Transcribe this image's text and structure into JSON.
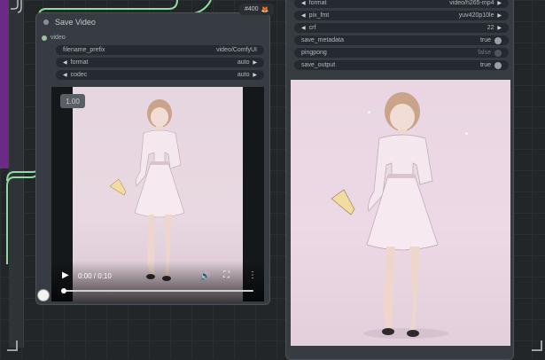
{
  "canvas": {
    "background_color": "#222629"
  },
  "left_node": {
    "title": "Save Video",
    "input_slot": "video",
    "widgets": [
      {
        "name": "filename_prefix",
        "value": "video/ComfyUI",
        "has_arrows": false
      },
      {
        "name": "format",
        "value": "auto",
        "has_arrows": true
      },
      {
        "name": "codec",
        "value": "auto",
        "has_arrows": true
      }
    ],
    "video_player": {
      "speed_badge": "1.00",
      "time": "0:00 / 0:10",
      "progress": 0.0
    }
  },
  "right_node": {
    "badge": "#400",
    "badge_icon": "fox-icon",
    "widgets": [
      {
        "name": "format",
        "value": "video/h265-mp4",
        "type": "combo"
      },
      {
        "name": "pix_fmt",
        "value": "yuv420p10le",
        "type": "combo"
      },
      {
        "name": "crf",
        "value": "22",
        "type": "number"
      },
      {
        "name": "save_metadata",
        "value": "true",
        "type": "toggle",
        "on": true
      },
      {
        "name": "pingpong",
        "value": "false",
        "type": "toggle",
        "on": false
      },
      {
        "name": "save_output",
        "value": "true",
        "type": "toggle",
        "on": true
      }
    ]
  },
  "colors": {
    "wire_green": "#8fdca0",
    "node_purple": "#6a2a86",
    "node_bg": "#363c42",
    "widget_bg": "#242a2f"
  }
}
